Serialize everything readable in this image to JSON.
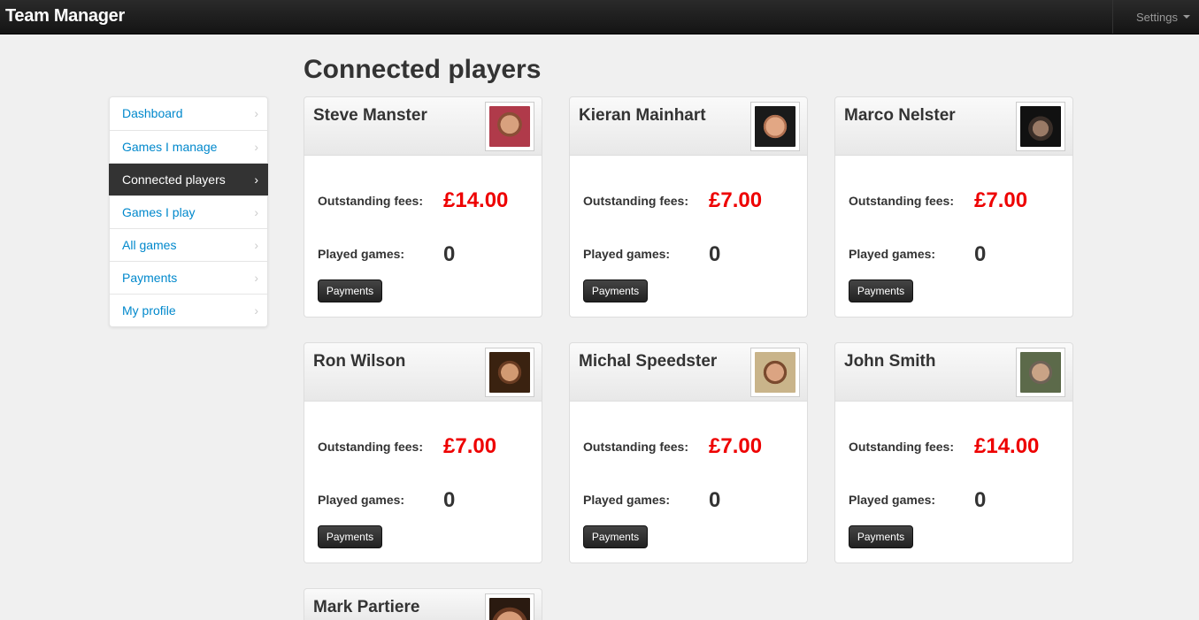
{
  "app": {
    "title": "Team Manager"
  },
  "navbar": {
    "settings_label": "Settings"
  },
  "sidebar": {
    "items": [
      {
        "label": "Dashboard",
        "active": false
      },
      {
        "label": "Games I manage",
        "active": false
      },
      {
        "label": "Connected players",
        "active": true
      },
      {
        "label": "Games I play",
        "active": false
      },
      {
        "label": "All games",
        "active": false
      },
      {
        "label": "Payments",
        "active": false
      },
      {
        "label": "My profile",
        "active": false
      }
    ]
  },
  "main": {
    "title": "Connected players",
    "fees_label": "Outstanding fees:",
    "games_label": "Played games:",
    "payments_button": "Payments",
    "players": [
      {
        "name": "Steve Manster",
        "fees": "£14.00",
        "played": "0"
      },
      {
        "name": "Kieran Mainhart",
        "fees": "£7.00",
        "played": "0"
      },
      {
        "name": "Marco Nelster",
        "fees": "£7.00",
        "played": "0"
      },
      {
        "name": "Ron Wilson",
        "fees": "£7.00",
        "played": "0"
      },
      {
        "name": "Michal Speedster",
        "fees": "£7.00",
        "played": "0"
      },
      {
        "name": "John Smith",
        "fees": "£14.00",
        "played": "0"
      },
      {
        "name": "Mark Partiere"
      }
    ]
  },
  "colors": {
    "fee": "#ee0000",
    "link": "#0088cc",
    "active_bg": "#333333"
  },
  "icons": {
    "nav_chevron": "chevron-right-icon",
    "settings_caret": "caret-down-icon"
  }
}
